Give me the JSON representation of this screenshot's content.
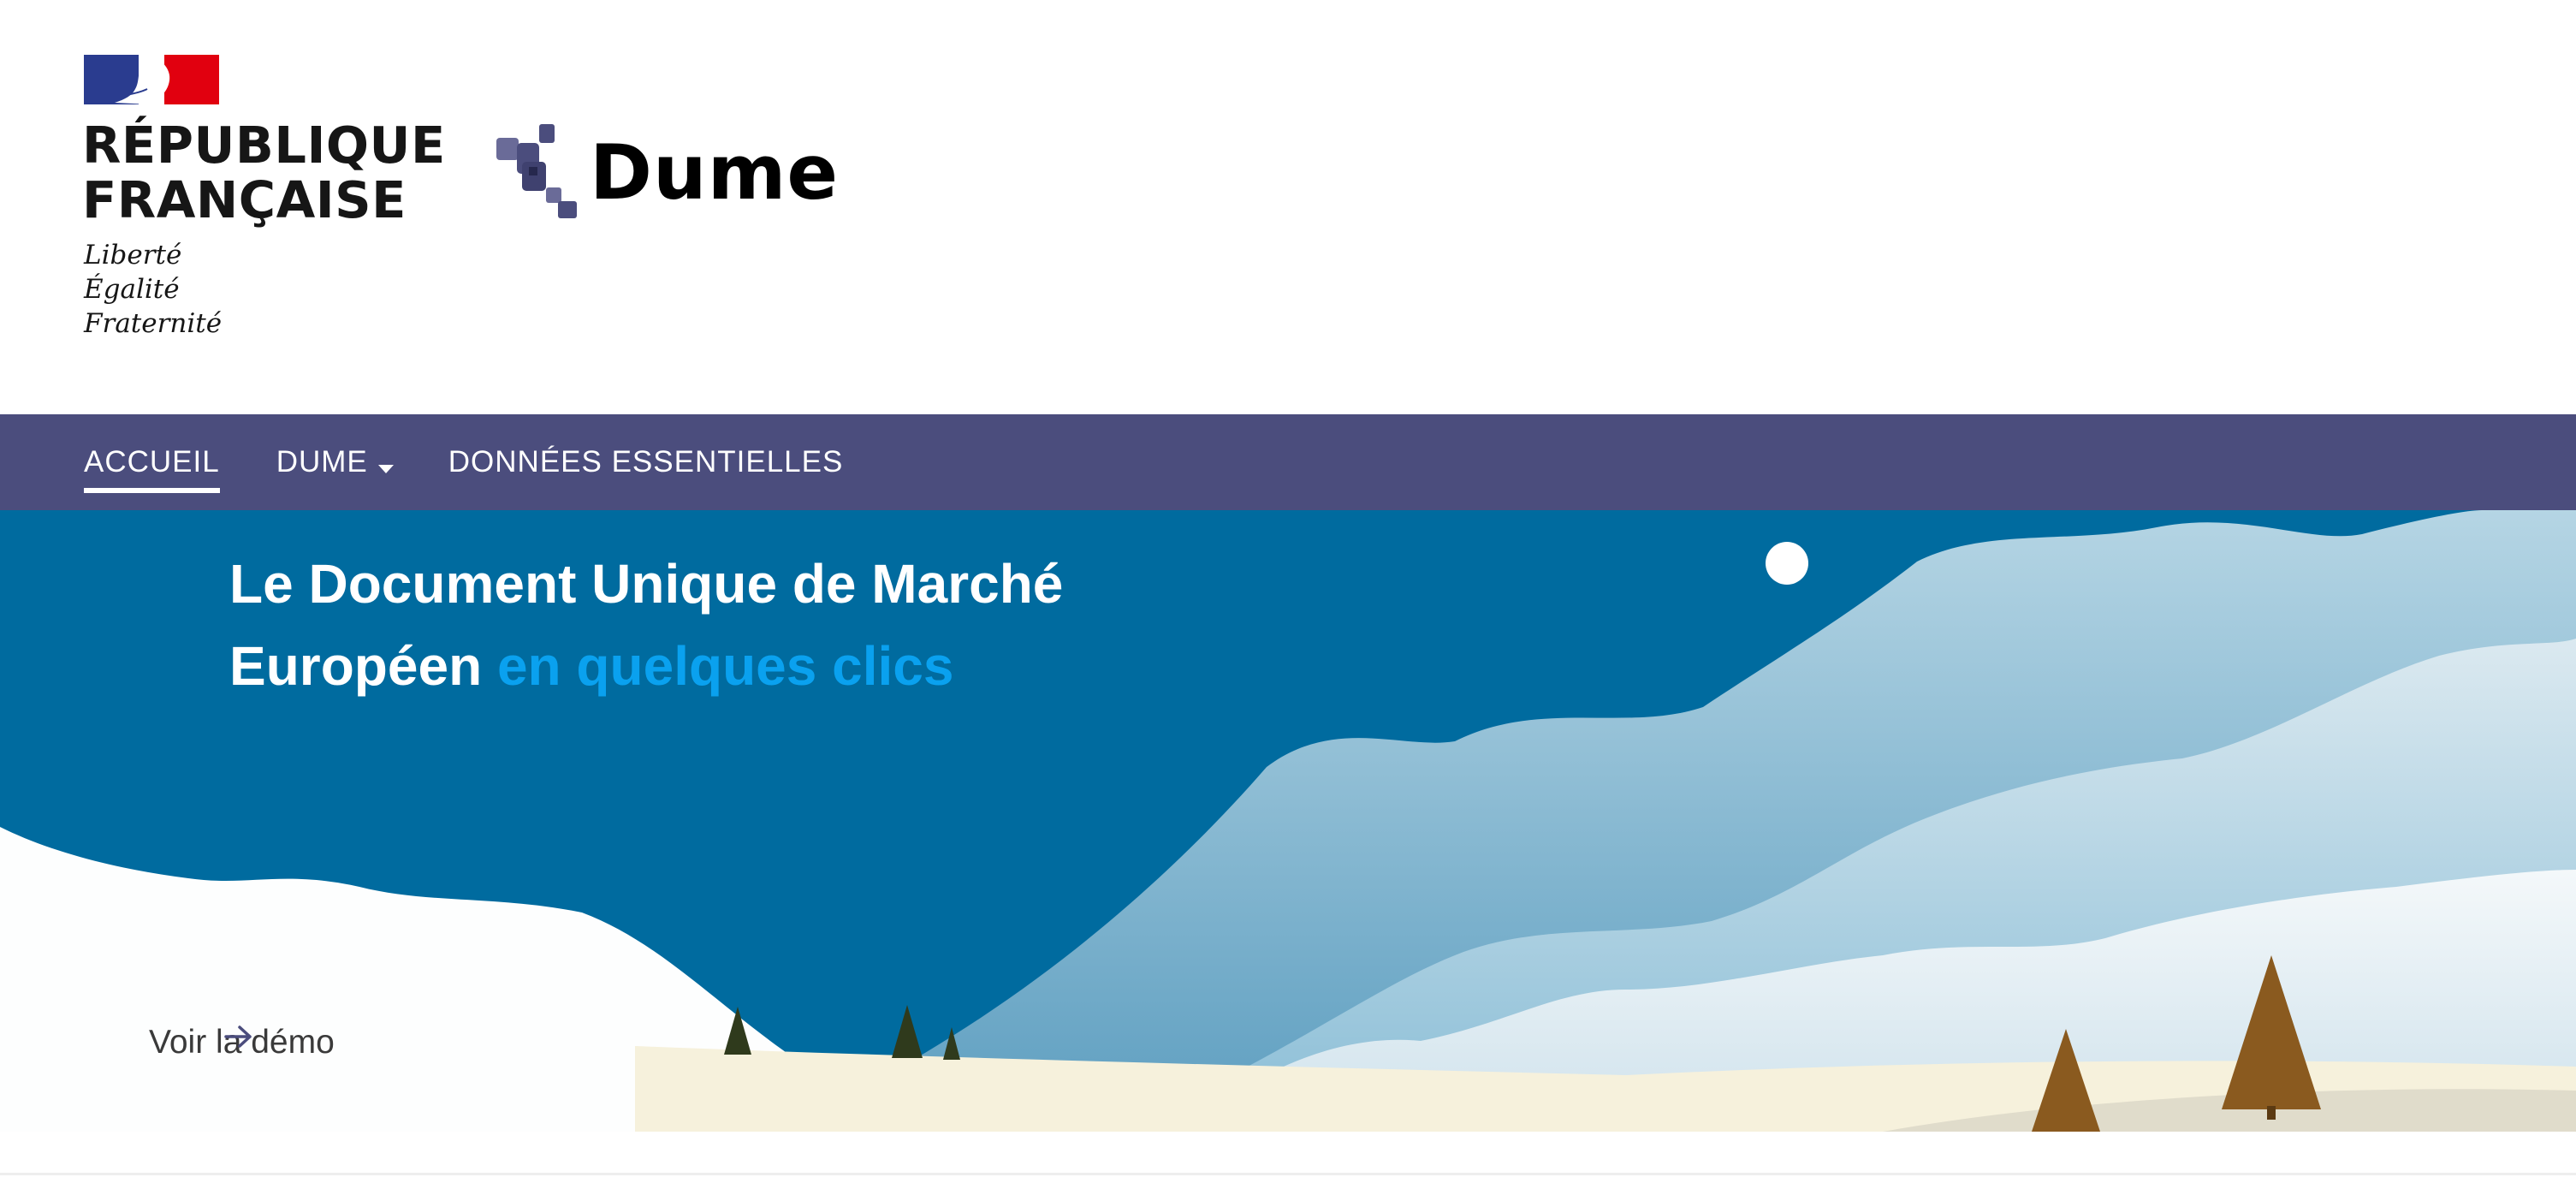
{
  "header": {
    "gov_name_line1": "RÉPUBLIQUE",
    "gov_name_line2": "FRANÇAISE",
    "motto_line1": "Liberté",
    "motto_line2": "Égalité",
    "motto_line3": "Fraternité",
    "service_name": "Dume"
  },
  "nav": {
    "items": [
      {
        "label": "ACCUEIL",
        "active": true
      },
      {
        "label": "DUME",
        "has_dropdown": true
      },
      {
        "label": "DONNÉES ESSENTIELLES"
      }
    ]
  },
  "hero": {
    "title_part1": "Le Document Unique de Marché Européen",
    "title_highlight": "en quelques clics",
    "cta_label": "Voir la démo",
    "cta_icon": "arrow-right-icon"
  },
  "colors": {
    "nav_bg": "#4b4d7d",
    "sky": "#006b9f",
    "highlight": "#0aa1ef",
    "flag_blue": "#000091",
    "flag_red": "#e1000f"
  }
}
